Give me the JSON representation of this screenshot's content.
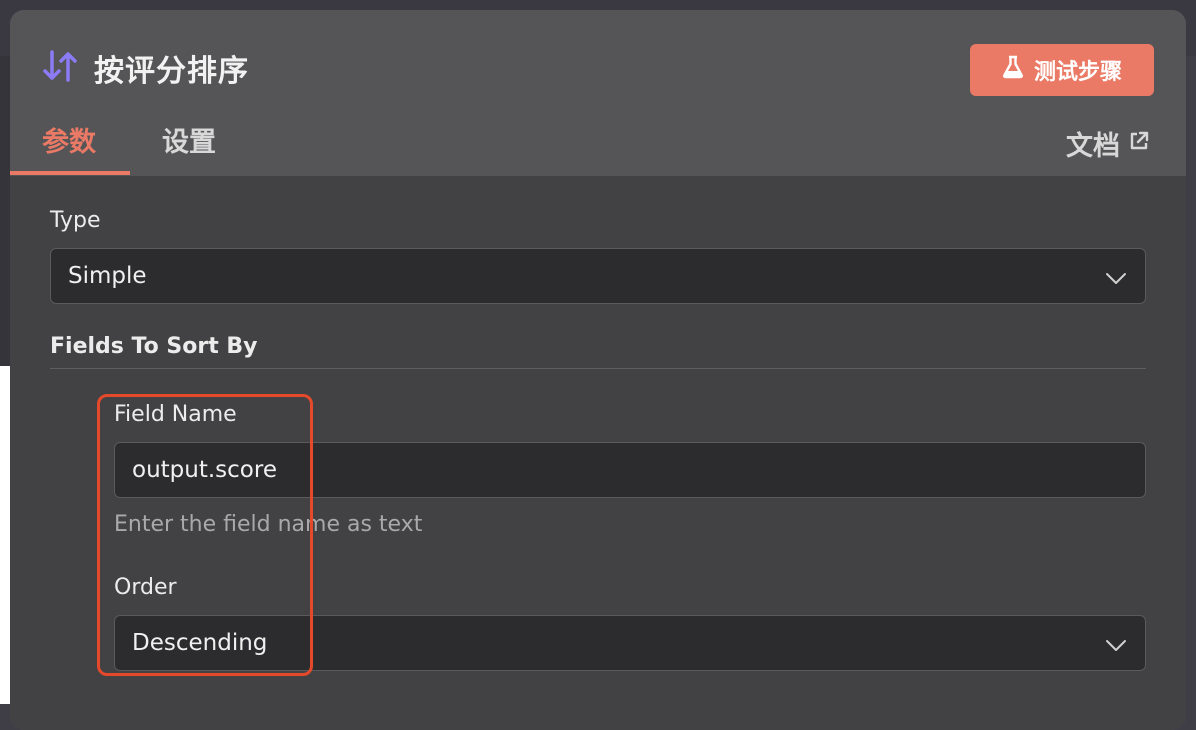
{
  "header": {
    "title": "按评分排序",
    "title_icon": "sort-arrows-icon",
    "test_button_label": "测试步骤",
    "test_button_icon": "flask-icon"
  },
  "tabs": [
    {
      "label": "参数",
      "active": true
    },
    {
      "label": "设置",
      "active": false
    }
  ],
  "docs": {
    "label": "文档",
    "icon": "external-link-icon"
  },
  "form": {
    "type_label": "Type",
    "type_value": "Simple",
    "fields_section_label": "Fields To Sort By",
    "field_name_label": "Field Name",
    "field_name_value": "output.score",
    "field_name_hint": "Enter the field name as text",
    "order_label": "Order",
    "order_value": "Descending"
  },
  "colors": {
    "accent": "#ea7a66",
    "icon_purple": "#8b7cf6",
    "highlight": "#e5492b"
  }
}
